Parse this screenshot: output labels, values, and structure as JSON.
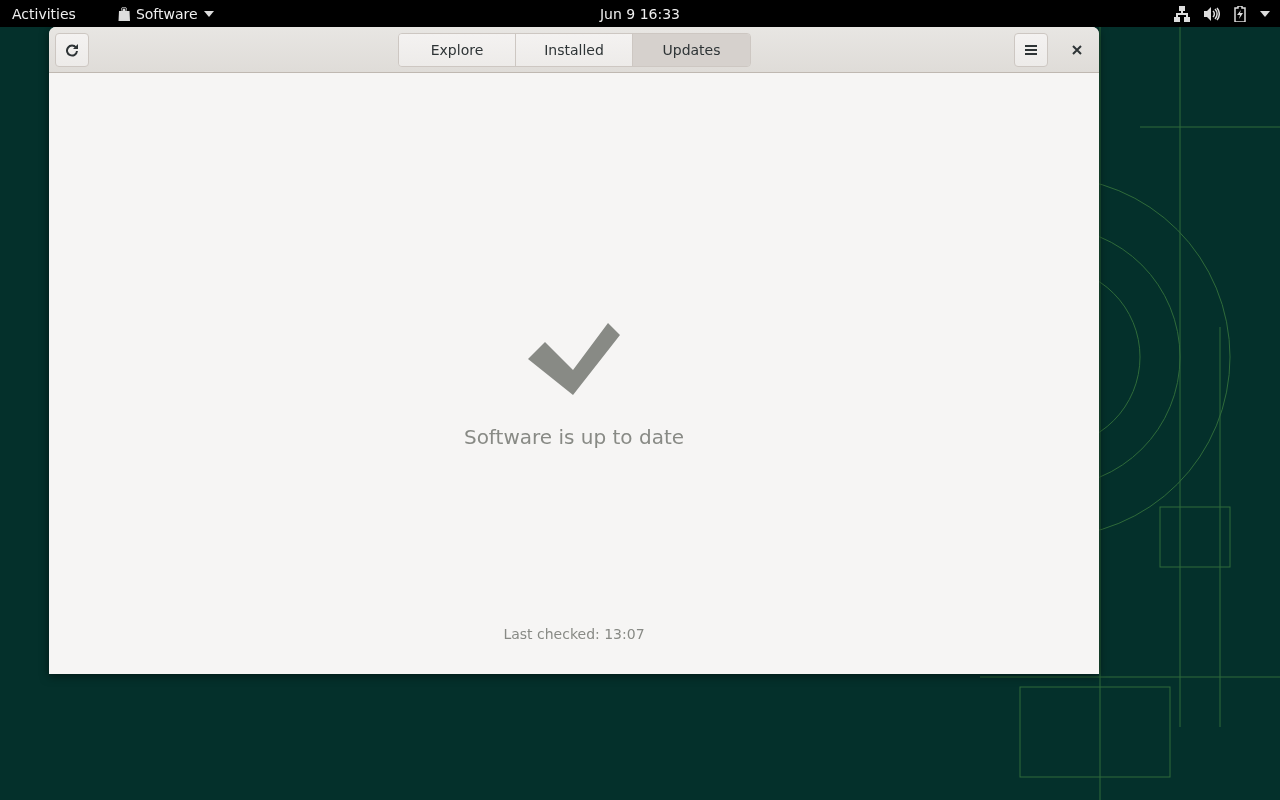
{
  "top_bar": {
    "activities": "Activities",
    "app_menu": "Software",
    "clock": "Jun 9  16:33"
  },
  "window": {
    "tabs": [
      {
        "label": "Explore",
        "selected": false
      },
      {
        "label": "Installed",
        "selected": false
      },
      {
        "label": "Updates",
        "selected": true
      }
    ],
    "status": {
      "title": "Software is up to date",
      "last_checked": "Last checked: 13:07"
    }
  }
}
